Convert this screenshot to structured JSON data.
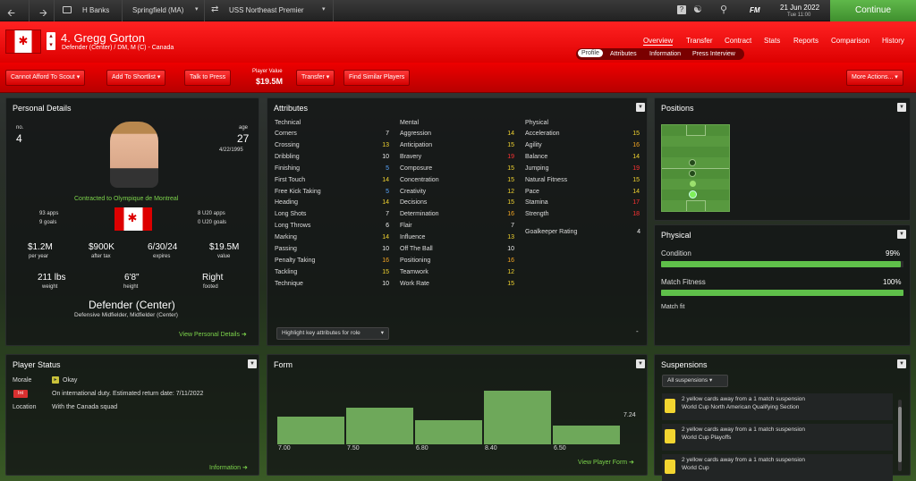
{
  "topbar": {
    "manager": "H Banks",
    "club": "Springfield (MA)",
    "league": "USS Northeast Premier",
    "fm": "FM",
    "date": "21 Jun 2022",
    "time": "Tue 11:00",
    "continue": "Continue"
  },
  "player": {
    "title": "4. Gregg Gorton",
    "subtitle": "Defender (Center) / DM, M (C) - Canada"
  },
  "nav": {
    "tabs": [
      "Overview",
      "Transfer",
      "Contract",
      "Stats",
      "Reports",
      "Comparison",
      "History"
    ],
    "subtabs": [
      "Profile",
      "Attributes",
      "Information",
      "Press Interview"
    ]
  },
  "actions": {
    "scout": "Cannot Afford To Scout",
    "shortlist": "Add To Shortlist",
    "press": "Talk to Press",
    "value_label": "Player Value",
    "value": "$19.5M",
    "transfer": "Transfer",
    "similar": "Find Similar Players",
    "more": "More Actions..."
  },
  "personal": {
    "title": "Personal Details",
    "no_label": "no.",
    "no": "4",
    "age_label": "age",
    "age": "27",
    "dob": "4/22/1995",
    "contract": "Contracted to Olympique de Montreal",
    "apps": "93 apps",
    "goals": "9 goals",
    "u20apps": "8 U20 apps",
    "u20goals": "0 U20 goals",
    "stats": [
      {
        "v": "$1.2M",
        "l": "per year"
      },
      {
        "v": "$900K",
        "l": "after tax"
      },
      {
        "v": "6/30/24",
        "l": "expires"
      },
      {
        "v": "$19.5M",
        "l": "value"
      }
    ],
    "body": [
      {
        "v": "211 lbs",
        "l": "weight"
      },
      {
        "v": "6'8\"",
        "l": "height"
      },
      {
        "v": "Right",
        "l": "footed"
      }
    ],
    "position": "Defender (Center)",
    "secondary": "Defensive Midfielder, Midfielder (Center)",
    "link": "View Personal Details"
  },
  "attributes": {
    "title": "Attributes",
    "headers": [
      "Technical",
      "Mental",
      "Physical"
    ],
    "technical": [
      [
        "Corners",
        "7",
        "w"
      ],
      [
        "Crossing",
        "13",
        "y"
      ],
      [
        "Dribbling",
        "10",
        "w"
      ],
      [
        "Finishing",
        "5",
        "b"
      ],
      [
        "First Touch",
        "14",
        "y"
      ],
      [
        "Free Kick Taking",
        "5",
        "b"
      ],
      [
        "Heading",
        "14",
        "y"
      ],
      [
        "Long Shots",
        "7",
        "w"
      ],
      [
        "Long Throws",
        "6",
        "w"
      ],
      [
        "Marking",
        "14",
        "y"
      ],
      [
        "Passing",
        "10",
        "w"
      ],
      [
        "Penalty Taking",
        "16",
        "o"
      ],
      [
        "Tackling",
        "15",
        "y"
      ],
      [
        "Technique",
        "10",
        "w"
      ]
    ],
    "mental": [
      [
        "Aggression",
        "14",
        "y"
      ],
      [
        "Anticipation",
        "15",
        "y"
      ],
      [
        "Bravery",
        "19",
        "r"
      ],
      [
        "Composure",
        "15",
        "y"
      ],
      [
        "Concentration",
        "15",
        "y"
      ],
      [
        "Creativity",
        "12",
        "y"
      ],
      [
        "Decisions",
        "15",
        "y"
      ],
      [
        "Determination",
        "16",
        "o"
      ],
      [
        "Flair",
        "7",
        "w"
      ],
      [
        "Influence",
        "13",
        "y"
      ],
      [
        "Off The Ball",
        "10",
        "w"
      ],
      [
        "Positioning",
        "16",
        "o"
      ],
      [
        "Teamwork",
        "12",
        "y"
      ],
      [
        "Work Rate",
        "15",
        "y"
      ]
    ],
    "physical": [
      [
        "Acceleration",
        "15",
        "y"
      ],
      [
        "Agility",
        "16",
        "o"
      ],
      [
        "Balance",
        "14",
        "y"
      ],
      [
        "Jumping",
        "19",
        "r"
      ],
      [
        "Natural Fitness",
        "15",
        "y"
      ],
      [
        "Pace",
        "14",
        "y"
      ],
      [
        "Stamina",
        "17",
        "r"
      ],
      [
        "Strength",
        "18",
        "r"
      ]
    ],
    "gk": [
      "Goalkeeper Rating",
      "4"
    ],
    "highlight": "Highlight key attributes for role"
  },
  "positions": {
    "title": "Positions"
  },
  "physical": {
    "title": "Physical",
    "condition_label": "Condition",
    "condition": "99%",
    "condition_value": 0.99,
    "fitness_label": "Match Fitness",
    "fitness": "100%",
    "fitness_value": 1.0,
    "matchfit": "Match fit"
  },
  "status": {
    "title": "Player Status",
    "morale_label": "Morale",
    "morale": "Okay",
    "int_badge": "Int",
    "int_text": "On international duty. Estimated return date: 7/11/2022",
    "location_label": "Location",
    "location": "With the Canada squad",
    "link": "Information"
  },
  "form": {
    "title": "Form",
    "avg": "7.24",
    "link": "View Player Form"
  },
  "chart_data": {
    "type": "bar",
    "categories": [
      "7.00",
      "7.50",
      "6.80",
      "8.40",
      "6.50"
    ],
    "values": [
      7.0,
      7.5,
      6.8,
      8.4,
      6.5
    ],
    "ylim": [
      5.5,
      8.6
    ]
  },
  "suspensions": {
    "title": "Suspensions",
    "filter": "All suspensions",
    "items": [
      {
        "l1": "2 yellow cards away from a 1 match suspension",
        "l2": "World Cup North American Qualifying Section"
      },
      {
        "l1": "2 yellow cards away from a 1 match suspension",
        "l2": "World Cup Playoffs"
      },
      {
        "l1": "2 yellow cards away from a 1 match suspension",
        "l2": "World Cup"
      }
    ]
  },
  "colors": {
    "red": "#e00000",
    "accent_green": "#5fc04a",
    "yellow": "#f3d530"
  }
}
